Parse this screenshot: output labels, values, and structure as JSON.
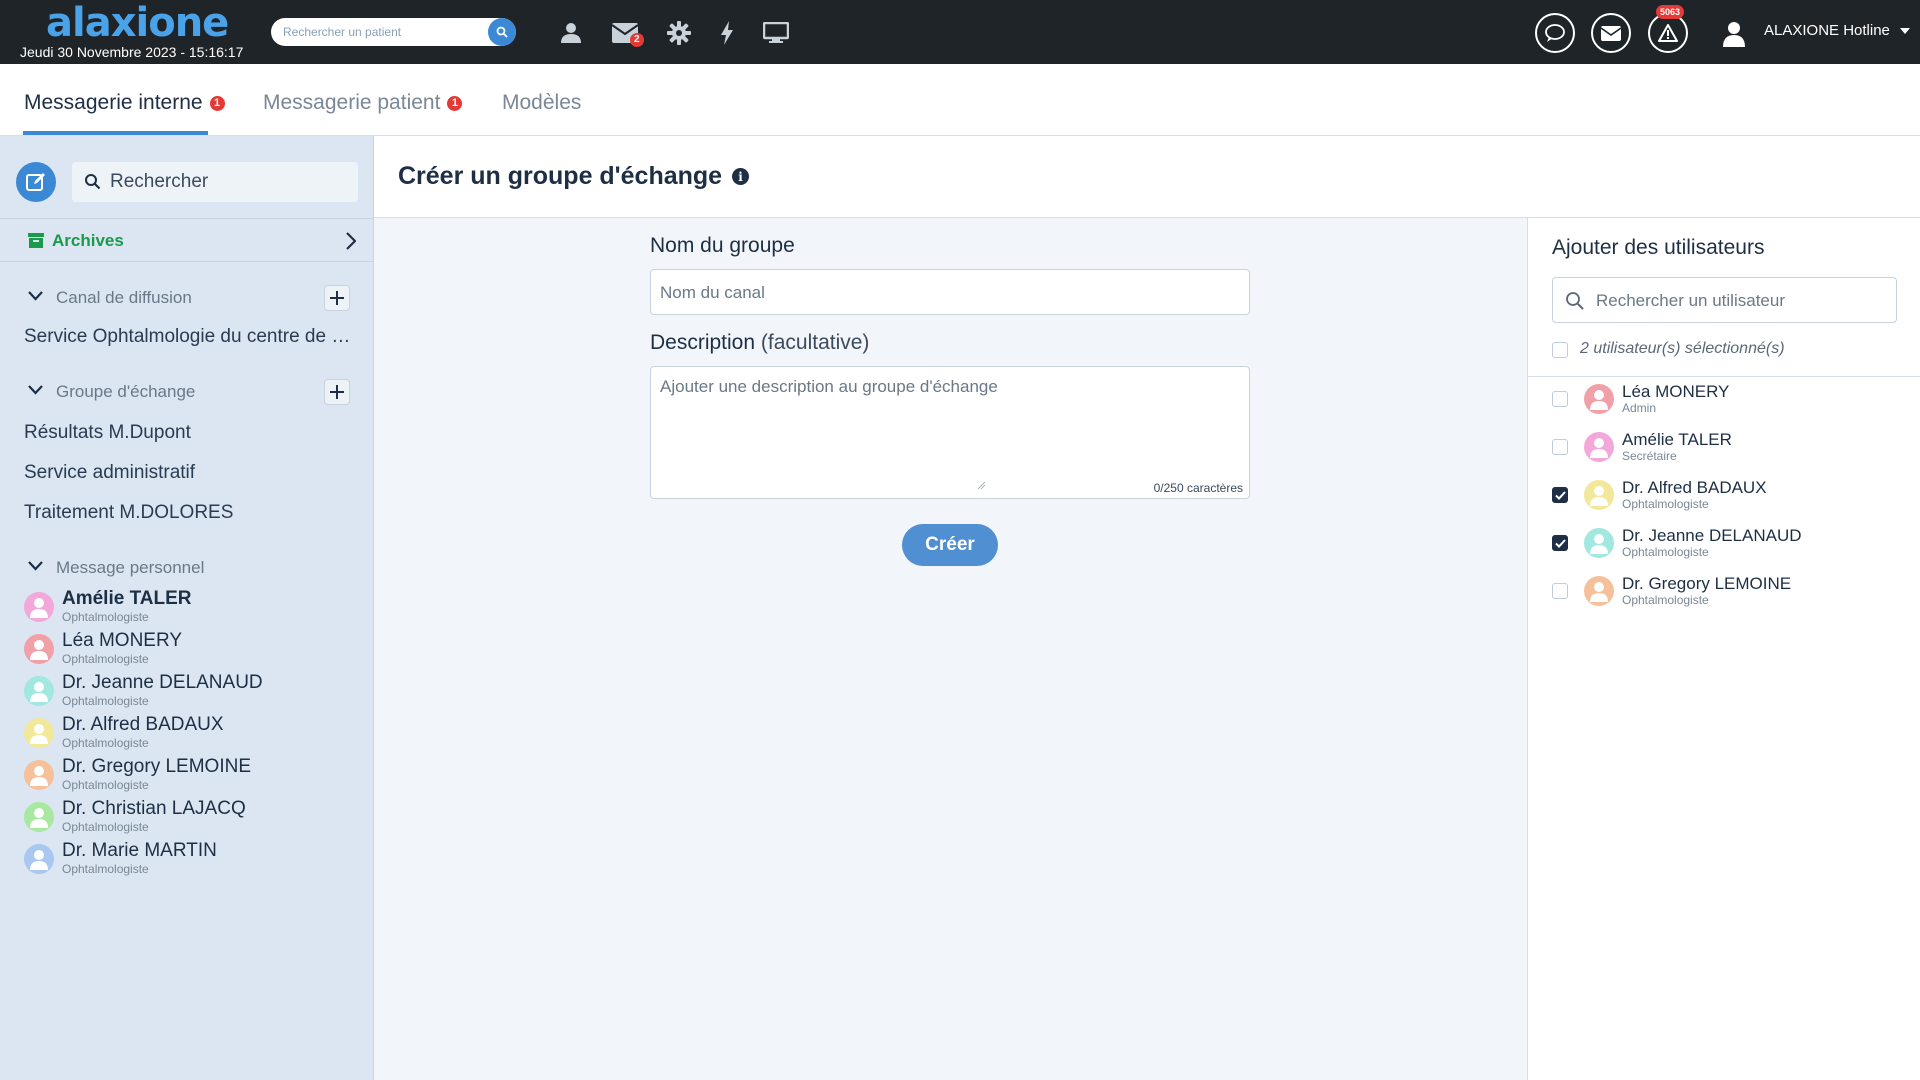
{
  "topbar": {
    "logo": "alaxione",
    "datetime": "Jeudi 30 Novembre 2023 - 15:16:17",
    "patient_search_placeholder": "Rechercher un patient",
    "mail_badge": "2",
    "alert_badge": "5063",
    "user_name": "ALAXIONE Hotline"
  },
  "tabs": [
    {
      "label": "Messagerie interne",
      "badge": "1"
    },
    {
      "label": "Messagerie patient",
      "badge": "1"
    },
    {
      "label": "Modèles"
    }
  ],
  "sidebar": {
    "search_placeholder": "Rechercher",
    "archives_label": "Archives",
    "broadcast": {
      "title": "Canal de diffusion",
      "items": [
        "Service Ophtalmologie du centre de Bruxelles"
      ]
    },
    "exchange": {
      "title": "Groupe d'échange",
      "items": [
        "Résultats M.Dupont",
        "Service administratif",
        "Traitement M.DOLORES"
      ]
    },
    "personal": {
      "title": "Message personnel",
      "people": [
        {
          "name": "Amélie TALER",
          "role": "Ophtalmologiste",
          "color": "#f2a8d8",
          "bold": true
        },
        {
          "name": "Léa MONERY",
          "role": "Ophtalmologiste",
          "color": "#f2a0a8"
        },
        {
          "name": "Dr. Jeanne DELANAUD",
          "role": "Ophtalmologiste",
          "color": "#a0e8e0"
        },
        {
          "name": "Dr. Alfred BADAUX",
          "role": "Ophtalmologiste",
          "color": "#f2e89a"
        },
        {
          "name": "Dr. Gregory LEMOINE",
          "role": "Ophtalmologiste",
          "color": "#f5c09a"
        },
        {
          "name": "Dr. Christian LAJACQ",
          "role": "Ophtalmologiste",
          "color": "#a8e8a0"
        },
        {
          "name": "Dr. Marie MARTIN",
          "role": "Ophtalmologiste",
          "color": "#a8c8f2"
        }
      ]
    }
  },
  "main": {
    "title": "Créer un groupe d'échange",
    "name_label": "Nom du groupe",
    "name_placeholder": "Nom du canal",
    "desc_label": "Description",
    "desc_optional": "(facultative)",
    "desc_placeholder": "Ajouter une description au groupe d'échange",
    "char_count": "0/250 caractères",
    "create_label": "Créer"
  },
  "users_panel": {
    "title": "Ajouter des utilisateurs",
    "search_placeholder": "Rechercher un utilisateur",
    "selected_text": "2 utilisateur(s) sélectionné(s)",
    "users": [
      {
        "name": "Léa MONERY",
        "role": "Admin",
        "color": "#f2a0a8",
        "checked": false
      },
      {
        "name": "Amélie TALER",
        "role": "Secrétaire",
        "color": "#f2a8d8",
        "checked": false
      },
      {
        "name": "Dr. Alfred BADAUX",
        "role": "Ophtalmologiste",
        "color": "#f2e89a",
        "checked": true
      },
      {
        "name": "Dr. Jeanne DELANAUD",
        "role": "Ophtalmologiste",
        "color": "#a0e8e0",
        "checked": true
      },
      {
        "name": "Dr. Gregory LEMOINE",
        "role": "Ophtalmologiste",
        "color": "#f5c09a",
        "checked": false
      }
    ]
  }
}
